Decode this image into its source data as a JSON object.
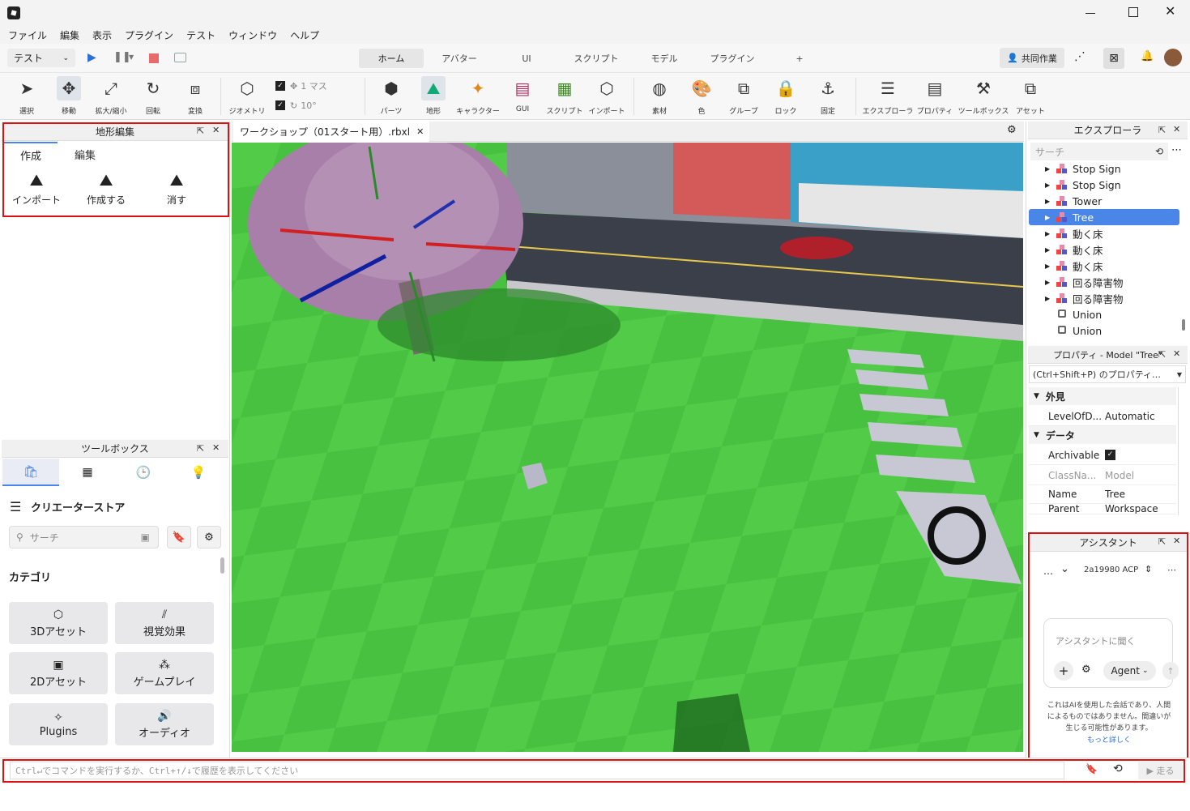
{
  "window": {
    "minimize_icon": "minimize-icon",
    "maximize_icon": "maximize-icon",
    "close_icon": "close-icon"
  },
  "menu": [
    "ファイル",
    "編集",
    "表示",
    "プラグイン",
    "テスト",
    "ウィンドウ",
    "ヘルプ"
  ],
  "toolbar": {
    "mode_select": "テスト",
    "tabs": [
      "ホーム",
      "アバター",
      "UI",
      "スクリプト",
      "モデル",
      "プラグイン",
      "+"
    ],
    "active_tab": "ホーム",
    "collab_label": "共同作業"
  },
  "ribbon": {
    "tools": [
      {
        "label": "選択",
        "icon": "cursor-icon"
      },
      {
        "label": "移動",
        "icon": "move-icon"
      },
      {
        "label": "拡大/縮小",
        "icon": "scale-icon"
      },
      {
        "label": "回転",
        "icon": "rotate-icon"
      },
      {
        "label": "変換",
        "icon": "transform-icon"
      }
    ],
    "geometry_label": "ジオメトリ",
    "move_step": "1 マス",
    "rotate_step": "10°",
    "tools2": [
      {
        "label": "パーツ"
      },
      {
        "label": "地形"
      },
      {
        "label": "キャラクター"
      },
      {
        "label": "GUI"
      },
      {
        "label": "スクリプト"
      },
      {
        "label": "インポート"
      }
    ],
    "tools3": [
      {
        "label": "素材"
      },
      {
        "label": "色"
      },
      {
        "label": "グループ"
      },
      {
        "label": "ロック"
      },
      {
        "label": "固定"
      }
    ],
    "tools4": [
      {
        "label": "エクスプローラ"
      },
      {
        "label": "プロパティ"
      },
      {
        "label": "ツールボックス"
      },
      {
        "label": "アセット"
      }
    ]
  },
  "terrain": {
    "title": "地形編集",
    "tabs": [
      "作成",
      "編集"
    ],
    "actions": [
      "インポート",
      "作成する",
      "消す"
    ]
  },
  "toolbox": {
    "title": "ツールボックス",
    "store_title": "クリエーターストア",
    "search_placeholder": "サーチ",
    "category_heading": "カテゴリ",
    "categories": [
      "3Dアセット",
      "視覚効果",
      "2Dアセット",
      "ゲームプレイ",
      "Plugins",
      "オーディオ"
    ]
  },
  "viewport": {
    "tab_title": "ワークショップ（01スタート用）.rbxl"
  },
  "explorer": {
    "title": "エクスプローラ",
    "search_placeholder": "サーチ",
    "items": [
      "Stop Sign",
      "Stop Sign",
      "Tower",
      "Tree",
      "動く床",
      "動く床",
      "動く床",
      "回る障害物",
      "回る障害物",
      "Union",
      "Union"
    ],
    "selected_index": 3
  },
  "properties": {
    "title": "プロパティ - Model \"Tree\"",
    "filter_placeholder": "(Ctrl+Shift+P) のプロパティ…",
    "sections": [
      {
        "name": "外見",
        "rows": [
          {
            "k": "LevelOfD...",
            "v": "Automatic"
          }
        ]
      },
      {
        "name": "データ",
        "rows": [
          {
            "k": "Archivable",
            "v": ""
          },
          {
            "k": "ClassNa...",
            "v": "Model"
          },
          {
            "k": "Name",
            "v": "Tree"
          },
          {
            "k": "Parent",
            "v": "Workspace"
          }
        ]
      }
    ]
  },
  "assistant": {
    "title": "アシスタント",
    "session": "2a19980 ACP",
    "placeholder": "アシスタントに聞く",
    "mode": "Agent",
    "disclaimer": "これはAIを使用した会話であり、人間によるものではありません。間違いが生じる可能性があります。",
    "learn_more": "もっと詳しく"
  },
  "command": {
    "placeholder": "Ctrl↵でコマンドを実行するか、Ctrl+↑/↓で履歴を表示してください",
    "run_label": "▶ 走る"
  },
  "colors": {
    "accent": "#4a86e8",
    "highlight": "#e01010"
  }
}
